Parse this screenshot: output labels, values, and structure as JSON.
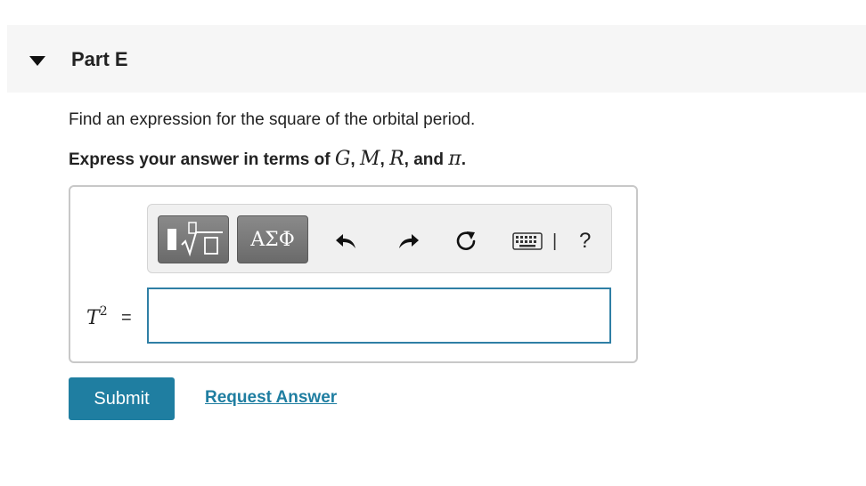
{
  "part": {
    "title": "Part E",
    "caret_icon": "caret-down-icon"
  },
  "question": {
    "text": "Find an expression for the square of the orbital period.",
    "instruction_prefix": "Express your answer in terms of ",
    "var_g": "G",
    "comma1": ", ",
    "var_m": "M",
    "comma2": ", ",
    "var_r": "R",
    "comma3": ", and ",
    "var_pi": "π",
    "period": "."
  },
  "toolbar": {
    "templates_icon": "templates-sqrt-icon",
    "symbols_label": "ΑΣΦ",
    "undo_icon": "undo-icon",
    "redo_icon": "redo-icon",
    "reset_icon": "reset-icon",
    "keyboard_icon": "keyboard-icon",
    "separator": "|",
    "help_label": "?"
  },
  "answer": {
    "variable": "T",
    "exponent": "2",
    "equals": "=",
    "value": ""
  },
  "actions": {
    "submit_label": "Submit",
    "request_label": "Request Answer"
  },
  "colors": {
    "accent": "#1f7ea1",
    "input_border": "#2f7fa5",
    "header_bg": "#f6f6f6"
  }
}
